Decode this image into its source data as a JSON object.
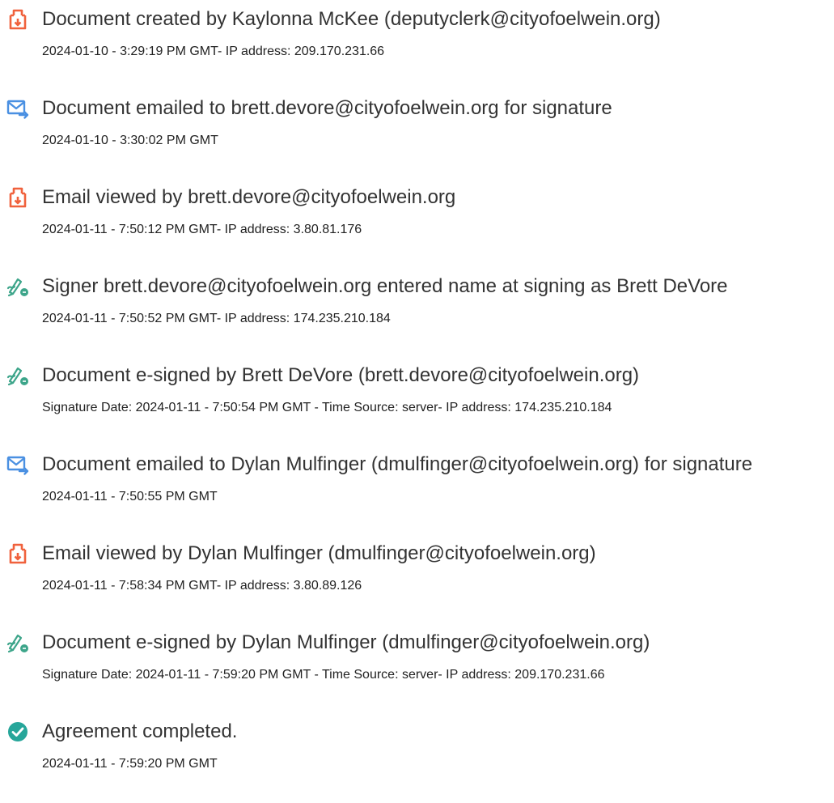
{
  "colors": {
    "doc_icon": "#F0613C",
    "email_icon": "#4A90E2",
    "sign_icon": "#3DA58A",
    "complete_icon": "#26A69A",
    "text": "#333333"
  },
  "events": [
    {
      "icon": "document-icon",
      "title": "Document created by Kaylonna McKee (deputyclerk@cityofoelwein.org)",
      "detail": "2024-01-10 - 3:29:19 PM GMT- IP address: 209.170.231.66"
    },
    {
      "icon": "email-send-icon",
      "title": "Document emailed to brett.devore@cityofoelwein.org for signature",
      "detail": "2024-01-10 - 3:30:02 PM GMT"
    },
    {
      "icon": "document-icon",
      "title": "Email viewed by brett.devore@cityofoelwein.org",
      "detail": "2024-01-11 - 7:50:12 PM GMT- IP address: 3.80.81.176"
    },
    {
      "icon": "signature-pen-icon",
      "title": "Signer brett.devore@cityofoelwein.org entered name at signing as Brett DeVore",
      "detail": "2024-01-11 - 7:50:52 PM GMT- IP address: 174.235.210.184"
    },
    {
      "icon": "signature-pen-icon",
      "title": "Document e-signed by Brett DeVore (brett.devore@cityofoelwein.org)",
      "detail": "Signature Date: 2024-01-11 - 7:50:54 PM GMT - Time Source: server- IP address: 174.235.210.184"
    },
    {
      "icon": "email-send-icon",
      "title": "Document emailed to Dylan Mulfinger (dmulfinger@cityofoelwein.org) for signature",
      "detail": "2024-01-11 - 7:50:55 PM GMT"
    },
    {
      "icon": "document-icon",
      "title": "Email viewed by Dylan Mulfinger (dmulfinger@cityofoelwein.org)",
      "detail": "2024-01-11 - 7:58:34 PM GMT- IP address: 3.80.89.126"
    },
    {
      "icon": "signature-pen-icon",
      "title": "Document e-signed by Dylan Mulfinger (dmulfinger@cityofoelwein.org)",
      "detail": "Signature Date: 2024-01-11 - 7:59:20 PM GMT - Time Source: server- IP address: 209.170.231.66"
    },
    {
      "icon": "check-circle-icon",
      "title": "Agreement completed.",
      "detail": "2024-01-11 - 7:59:20 PM GMT"
    }
  ]
}
